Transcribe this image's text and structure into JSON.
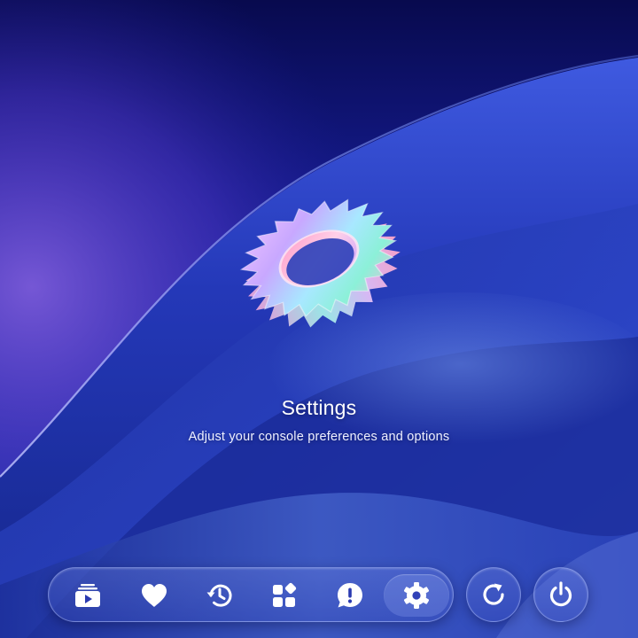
{
  "main": {
    "title": "Settings",
    "subtitle": "Adjust your console preferences and options",
    "hero_icon": "gear-icon"
  },
  "dock": {
    "items": [
      {
        "name": "library",
        "icon": "media-library-icon",
        "active": false
      },
      {
        "name": "favorites",
        "icon": "heart-icon",
        "active": false
      },
      {
        "name": "history",
        "icon": "history-icon",
        "active": false
      },
      {
        "name": "apps",
        "icon": "apps-grid-icon",
        "active": false
      },
      {
        "name": "alerts",
        "icon": "alert-bubble-icon",
        "active": false
      },
      {
        "name": "settings",
        "icon": "gear-icon",
        "active": true
      }
    ]
  },
  "system_buttons": [
    {
      "name": "restart",
      "icon": "restart-icon"
    },
    {
      "name": "power",
      "icon": "power-icon"
    }
  ],
  "colors": {
    "background_top": "#080a4e",
    "background_bottom": "#1a36a6",
    "icon": "#ffffff",
    "text": "#ffffff"
  }
}
